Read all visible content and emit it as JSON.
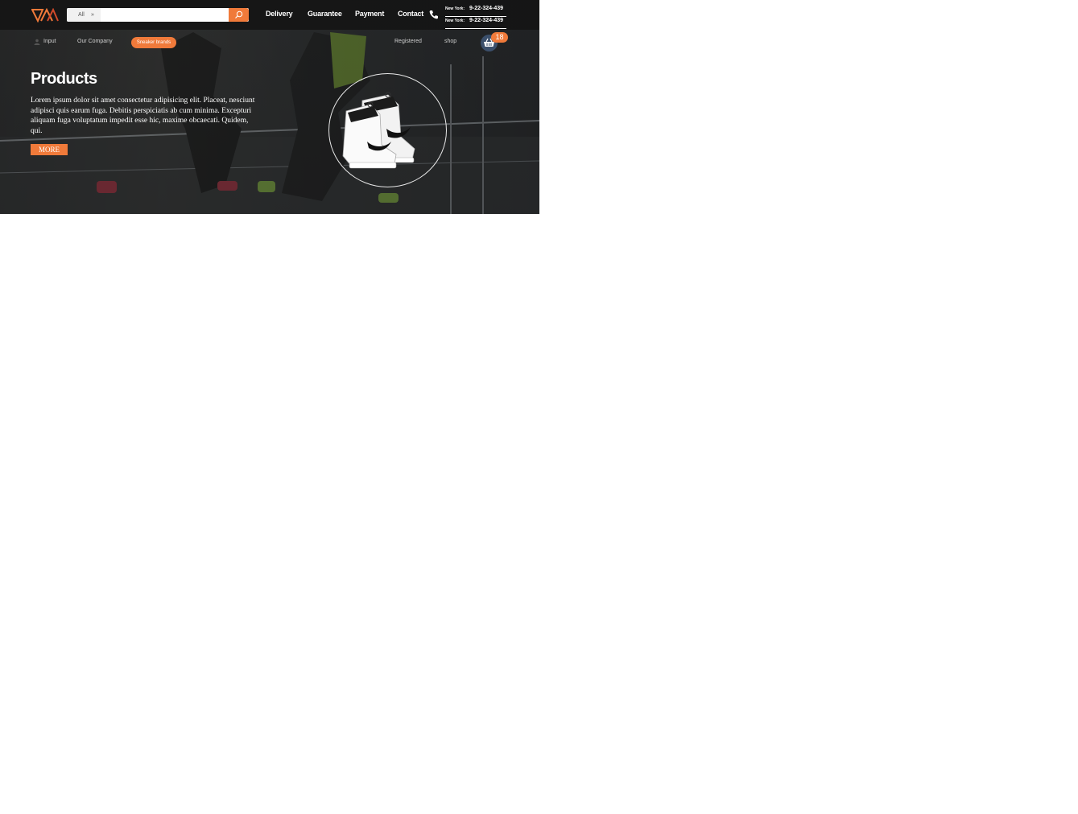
{
  "header": {
    "search": {
      "category": "All",
      "placeholder": ""
    },
    "nav": [
      "Delivery",
      "Guarantee",
      "Payment",
      "Contact"
    ],
    "phones": [
      {
        "city": "New York:",
        "number": "9-22-324-439"
      },
      {
        "city": "New York:",
        "number": "9-22-324-439"
      }
    ]
  },
  "subnav": {
    "login": "Input",
    "company": "Our Company",
    "brands": "Sneaker brands",
    "registered": "Registered",
    "shop": "shop",
    "cart_count": "18"
  },
  "hero": {
    "title": "Products",
    "description": "Lorem ipsum dolor sit amet consectetur adipisicing elit. Placeat, nesciunt adipisci quis earum fuga. Debitis perspiciatis ab cum minima. Excepturi aliquam fuga voluptatum impedit esse hic, maxime obcaecati. Quidem, qui.",
    "more_label": "MORE"
  },
  "colors": {
    "accent": "#f07a3a",
    "cart": "#3b4f6b",
    "header_bg": "#141414"
  },
  "icons": [
    "logo-icon",
    "chevron-down-icon",
    "search-icon",
    "phone-icon",
    "user-icon",
    "basket-icon",
    "sneaker-image"
  ]
}
